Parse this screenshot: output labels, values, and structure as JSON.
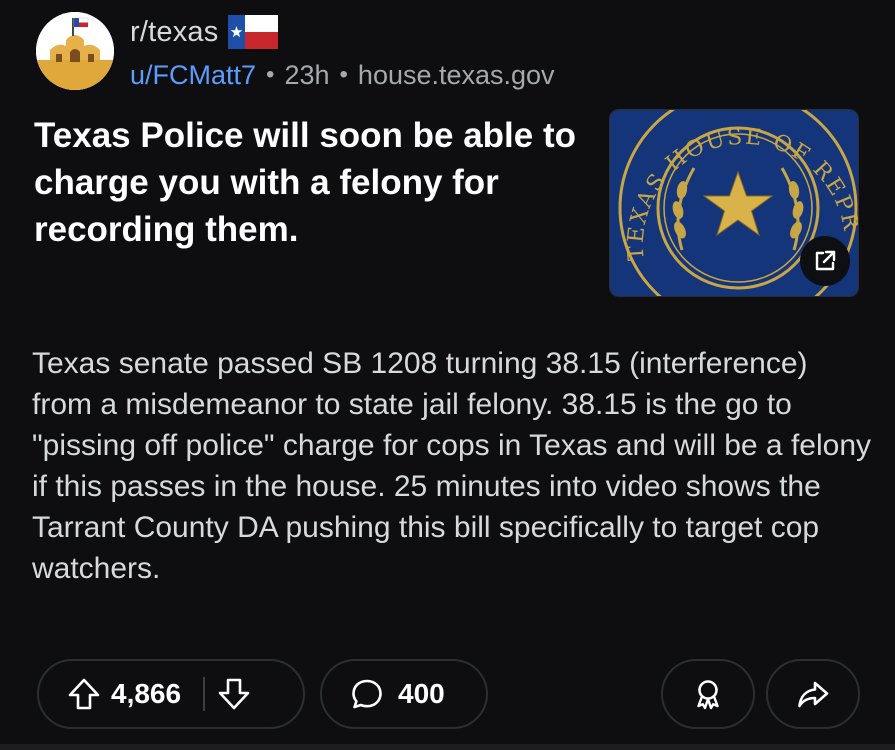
{
  "header": {
    "subreddit": "r/texas",
    "username": "u/FCMatt7",
    "separator": "•",
    "age": "23h",
    "domain": "house.texas.gov"
  },
  "post": {
    "title": "Texas Police will soon be able to charge you with a felony for recording them.",
    "body": "Texas senate passed SB 1208 turning 38.15 (interference) from a misdemeanor to state jail felony. 38.15 is the go to \"pissing off police\" charge for cops in Texas and will be a felony if this passes in the house. 25 minutes into video shows the Tarrant County DA pushing this bill specifically to target cop watchers.",
    "thumbnail_text": "TEXAS HOUSE OF REPRESENTATIVES"
  },
  "actions": {
    "upvotes": "4,866",
    "comments": "400"
  },
  "icons": {
    "avatar": "alamo-avatar-icon",
    "flair": "texas-flag-icon",
    "external_link": "external-link-icon",
    "upvote": "upvote-arrow-icon",
    "downvote": "downvote-arrow-icon",
    "comment": "comment-bubble-icon",
    "award": "award-icon",
    "share": "share-arrow-icon"
  },
  "colors": {
    "background": "#0e0e10",
    "username": "#5b9dff",
    "seal_blue": "#15357a",
    "seal_gold": "#c9a645"
  }
}
